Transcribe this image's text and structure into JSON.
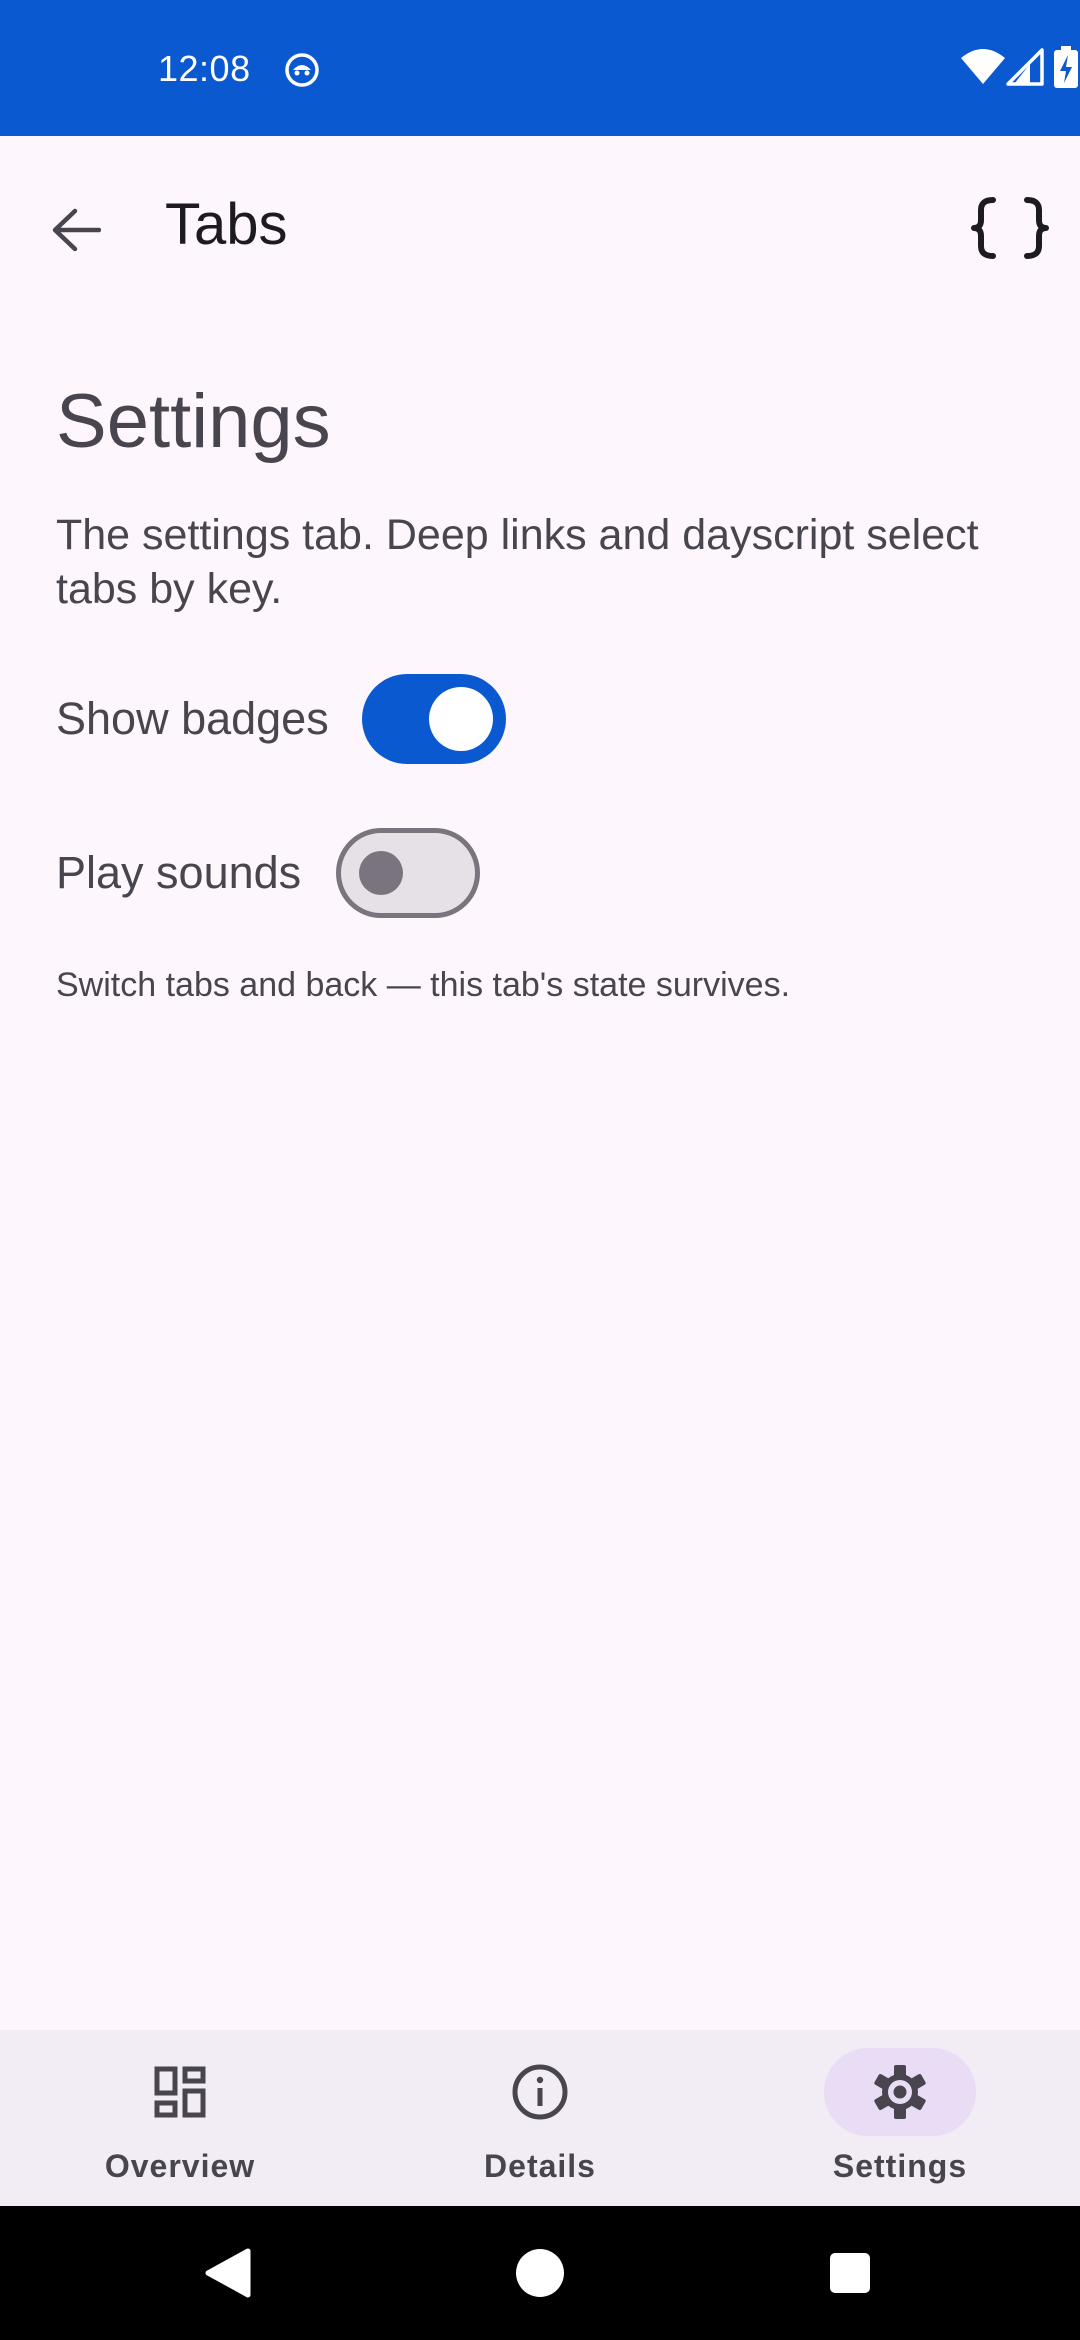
{
  "status_bar": {
    "time": "12:08",
    "icons": [
      "app-notification-icon",
      "wifi-icon",
      "signal-icon",
      "battery-charging-icon"
    ]
  },
  "app_bar": {
    "title": "Tabs",
    "back_icon": "arrow-back-icon",
    "action_icon": "code-braces-icon"
  },
  "content": {
    "heading": "Settings",
    "description": "The settings tab. Deep links and dayscript select tabs by key.",
    "settings": [
      {
        "label": "Show badges",
        "checked": true
      },
      {
        "label": "Play sounds",
        "checked": false
      }
    ],
    "footnote": "Switch tabs and back — this tab's state survives."
  },
  "bottom_nav": {
    "active": "Settings",
    "items": [
      {
        "label": "Overview",
        "icon": "dashboard-icon"
      },
      {
        "label": "Details",
        "icon": "info-icon"
      },
      {
        "label": "Settings",
        "icon": "gear-icon"
      }
    ]
  },
  "colors": {
    "primary": "#0b59d1",
    "background": "#fdf7fd",
    "nav_background": "#f2ecf4",
    "nav_indicator": "#e8ddf5",
    "text_secondary": "#49454f",
    "outline": "#79747e"
  }
}
